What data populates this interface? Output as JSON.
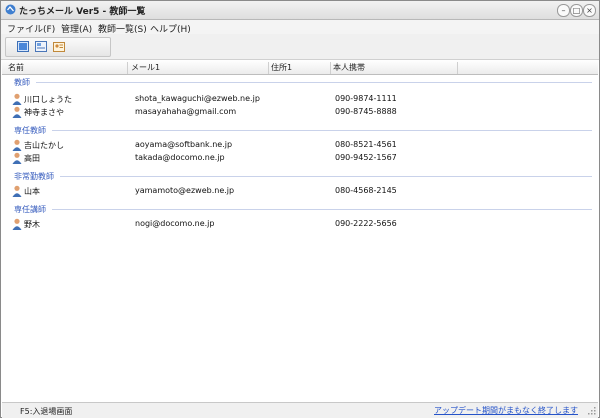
{
  "window": {
    "title": "たっちメール Ver5 - 教師一覧"
  },
  "menu": [
    "ファイル(F)",
    "管理(A)",
    "教師一覧(S)",
    "ヘルプ(H)"
  ],
  "table": {
    "columns": [
      "名前",
      "メール1",
      "住所1",
      "本人携帯"
    ],
    "groups": [
      {
        "label": "教師",
        "rows": [
          {
            "name": "川口しょうた",
            "email": "shota_kawaguchi@ezweb.ne.jp",
            "phone": "090-9874-1111"
          },
          {
            "name": "神寺まさや",
            "email": "masayahaha@gmail.com",
            "phone": "090-8745-8888"
          }
        ]
      },
      {
        "label": "専任教師",
        "rows": [
          {
            "name": "吉山たかし",
            "email": "aoyama@softbank.ne.jp",
            "phone": "080-8521-4561"
          },
          {
            "name": "高田",
            "email": "takada@docomo.ne.jp",
            "phone": "090-9452-1567"
          }
        ]
      },
      {
        "label": "非常勤教師",
        "rows": [
          {
            "name": "山本",
            "email": "yamamoto@ezweb.ne.jp",
            "phone": "080-4568-2145"
          }
        ]
      },
      {
        "label": "専任講師",
        "rows": [
          {
            "name": "野木",
            "email": "nogi@docomo.ne.jp",
            "phone": "090-2222-5656"
          }
        ]
      }
    ]
  },
  "status": {
    "left": "F5:入退場画面",
    "link": "アップデート期間がまもなく終了します"
  },
  "colors": {
    "group_label": "#3a5fbf",
    "link": "#2553c9"
  }
}
